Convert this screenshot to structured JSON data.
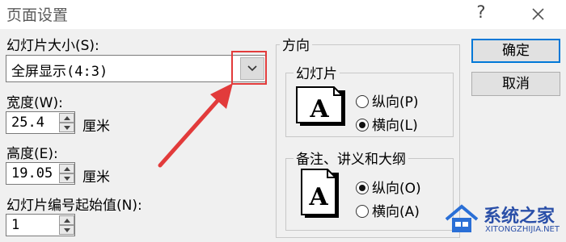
{
  "dialog": {
    "title": "页面设置",
    "help": "?"
  },
  "slide_size": {
    "label": "幻灯片大小(S):",
    "value": "全屏显示(4:3)"
  },
  "width": {
    "label": "宽度(W):",
    "value": "25.4",
    "unit": "厘米"
  },
  "height": {
    "label": "高度(E):",
    "value": "19.05",
    "unit": "厘米"
  },
  "start_number": {
    "label": "幻灯片编号起始值(N):",
    "value": "1"
  },
  "orientation": {
    "title": "方向",
    "slides": {
      "title": "幻灯片",
      "options": [
        {
          "label": "纵向(P)",
          "selected": false
        },
        {
          "label": "横向(L)",
          "selected": true
        }
      ]
    },
    "notes": {
      "title": "备注、讲义和大纲",
      "options": [
        {
          "label": "纵向(O)",
          "selected": true
        },
        {
          "label": "横向(A)",
          "selected": false
        }
      ]
    }
  },
  "buttons": {
    "ok": "确定",
    "cancel": "取消"
  },
  "watermark": {
    "name": "系统之家",
    "url": "XITONGZHIJIA.NET"
  },
  "colors": {
    "annotation": "#e23b3b",
    "accent": "#0078d7"
  }
}
